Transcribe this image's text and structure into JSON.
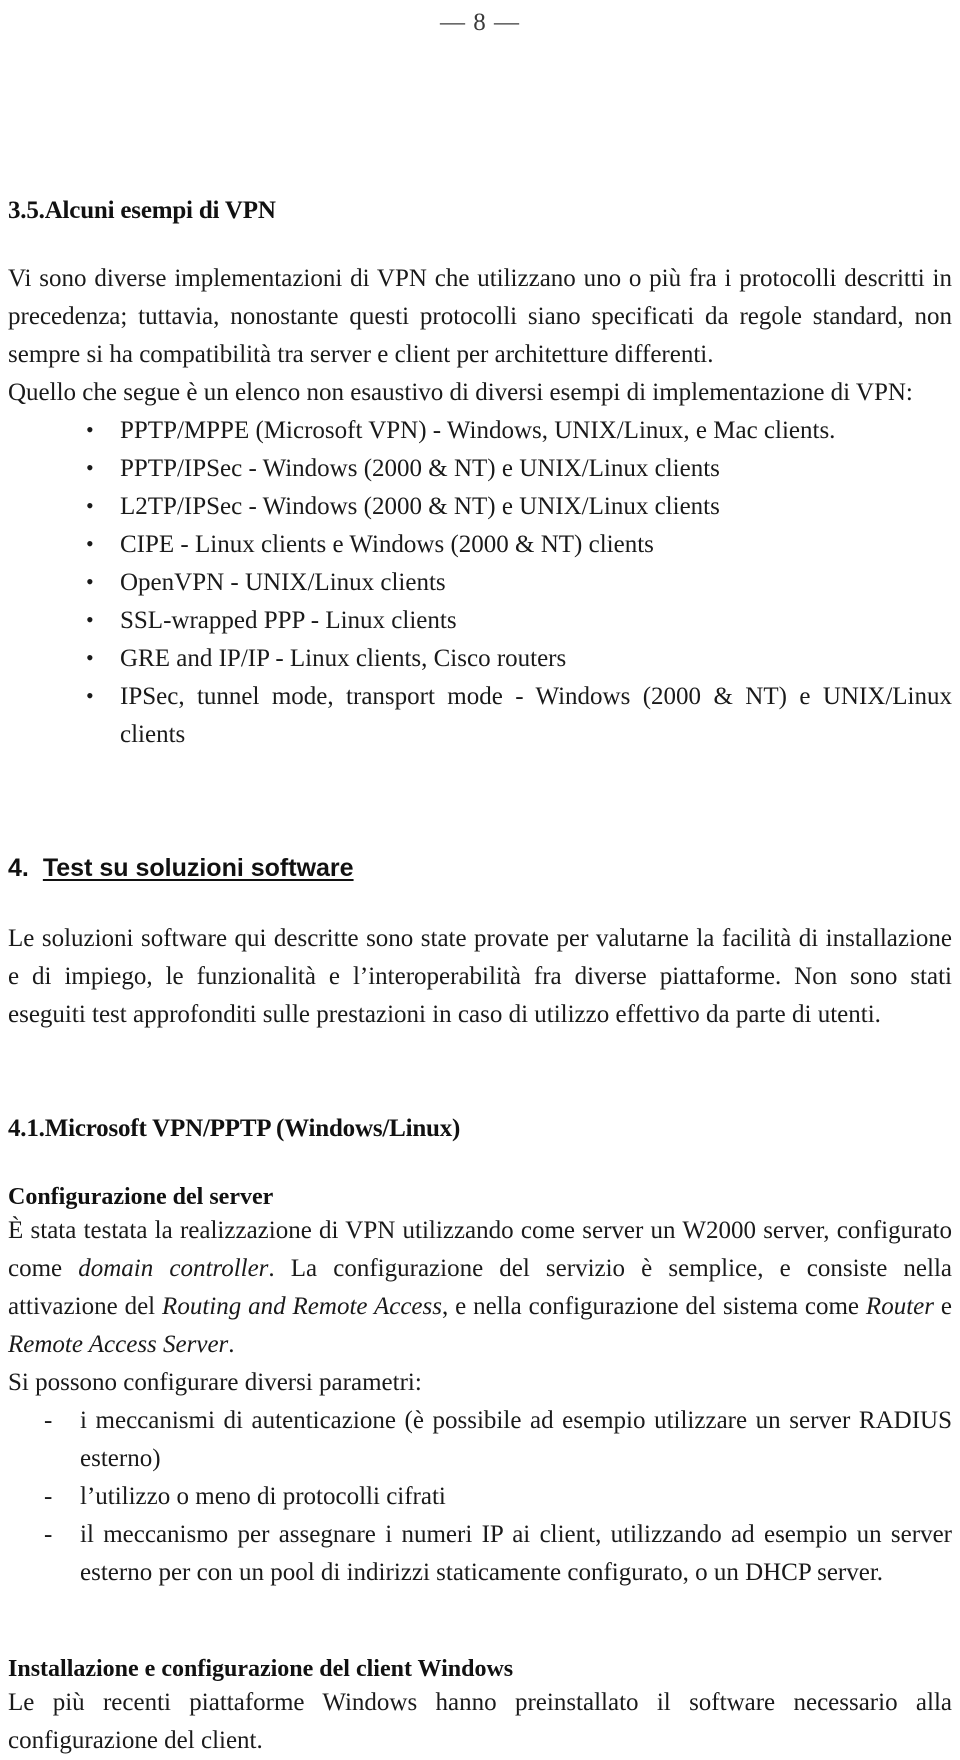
{
  "document": {
    "page_number_label": "— 8 —",
    "language": "it"
  },
  "section_3_5": {
    "heading_number": "3.5.",
    "heading_title": "Alcuni esempi di VPN",
    "paragraph_1": "Vi sono diverse implementazioni di VPN che utilizzano uno o più fra i protocolli descritti in precedenza; tuttavia, nonostante questi protocolli siano specificati da regole standard, non sempre si ha compatibilità tra server e client per architetture differenti.",
    "paragraph_2": "Quello che segue è un elenco non esaustivo di diversi esempi di implementazione di VPN:",
    "bullets": [
      "PPTP/MPPE (Microsoft VPN) - Windows, UNIX/Linux, e Mac clients.",
      "PPTP/IPSec - Windows (2000 & NT) e UNIX/Linux clients",
      "L2TP/IPSec - Windows (2000 & NT) e UNIX/Linux clients",
      "CIPE - Linux clients e Windows (2000 & NT) clients",
      "OpenVPN - UNIX/Linux clients",
      "SSL-wrapped PPP - Linux clients",
      "GRE and IP/IP - Linux clients, Cisco routers",
      "IPSec, tunnel mode, transport mode - Windows (2000 & NT) e UNIX/Linux clients"
    ]
  },
  "section_4": {
    "heading_number": "4.",
    "heading_title": "Test su soluzioni software",
    "paragraph_1": "Le soluzioni software qui descritte sono state provate per valutarne la facilità di installazione e di impiego, le funzionalità e l’interoperabilità fra diverse piattaforme. Non sono stati eseguiti test approfonditi sulle prestazioni in caso di utilizzo effettivo da parte di utenti."
  },
  "section_4_1": {
    "heading_number": "4.1.",
    "heading_title": "Microsoft VPN/PPTP (Windows/Linux)",
    "sub_heading_server": "Configurazione del server",
    "server_paragraph_parts": {
      "p1": "È stata testata la realizzazione di VPN utilizzando come server un W2000 server, configurato come ",
      "i1": "domain controller",
      "p2": ". La configurazione del servizio è semplice, e consiste nella attivazione del ",
      "i2": "Routing and Remote Access",
      "p3": ", e nella configurazione del sistema come ",
      "i3": "Router",
      "p4": " e ",
      "i4": "Remote Access Server",
      "p5": "."
    },
    "params_intro": "Si possono configurare diversi parametri:",
    "params": [
      "i meccanismi di autenticazione (è possibile ad esempio utilizzare un server RADIUS esterno)",
      "l’utilizzo o meno di protocolli cifrati",
      "il meccanismo per assegnare i numeri IP ai client, utilizzando ad esempio un server esterno per con un pool di indirizzi staticamente configurato, o un DHCP server."
    ],
    "sub_heading_client": "Installazione e configurazione del client Windows",
    "client_paragraph": "Le più recenti piattaforme Windows hanno preinstallato il software necessario alla configurazione del client."
  }
}
